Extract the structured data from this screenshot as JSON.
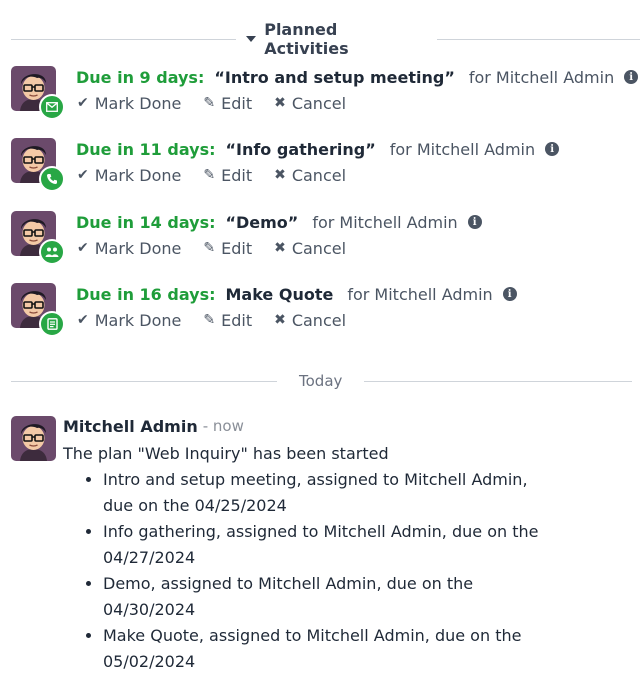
{
  "planned": {
    "title": "Planned Activities",
    "activities": [
      {
        "due": "Due in 9 days:",
        "summary": "“Intro and setup meeting”",
        "assignee": "for Mitchell Admin",
        "type_icon": "envelope-icon"
      },
      {
        "due": "Due in 11 days:",
        "summary": "“Info gathering”",
        "assignee": "for Mitchell Admin",
        "type_icon": "phone-icon"
      },
      {
        "due": "Due in 14 days:",
        "summary": "“Demo”",
        "assignee": "for Mitchell Admin",
        "type_icon": "meeting-icon"
      },
      {
        "due": "Due in 16 days:",
        "summary": "Make Quote",
        "assignee": "for Mitchell Admin",
        "type_icon": "document-icon"
      }
    ],
    "actions": {
      "mark_done": "Mark Done",
      "edit": "Edit",
      "cancel": "Cancel"
    }
  },
  "separator": {
    "label": "Today"
  },
  "message": {
    "author": "Mitchell Admin",
    "timestamp": "- now",
    "text": "The plan \"Web Inquiry\" has been started",
    "items": [
      "Intro and setup meeting, assigned to Mitchell Admin, due on the 04/25/2024",
      "Info gathering, assigned to Mitchell Admin, due on the 04/27/2024",
      "Demo, assigned to Mitchell Admin, due on the 04/30/2024",
      "Make Quote, assigned to Mitchell Admin, due on the 05/02/2024"
    ]
  },
  "colors": {
    "due_green": "#1f9d3a",
    "badge_green": "#28a745",
    "avatar_bg": "#6b4a6b"
  }
}
